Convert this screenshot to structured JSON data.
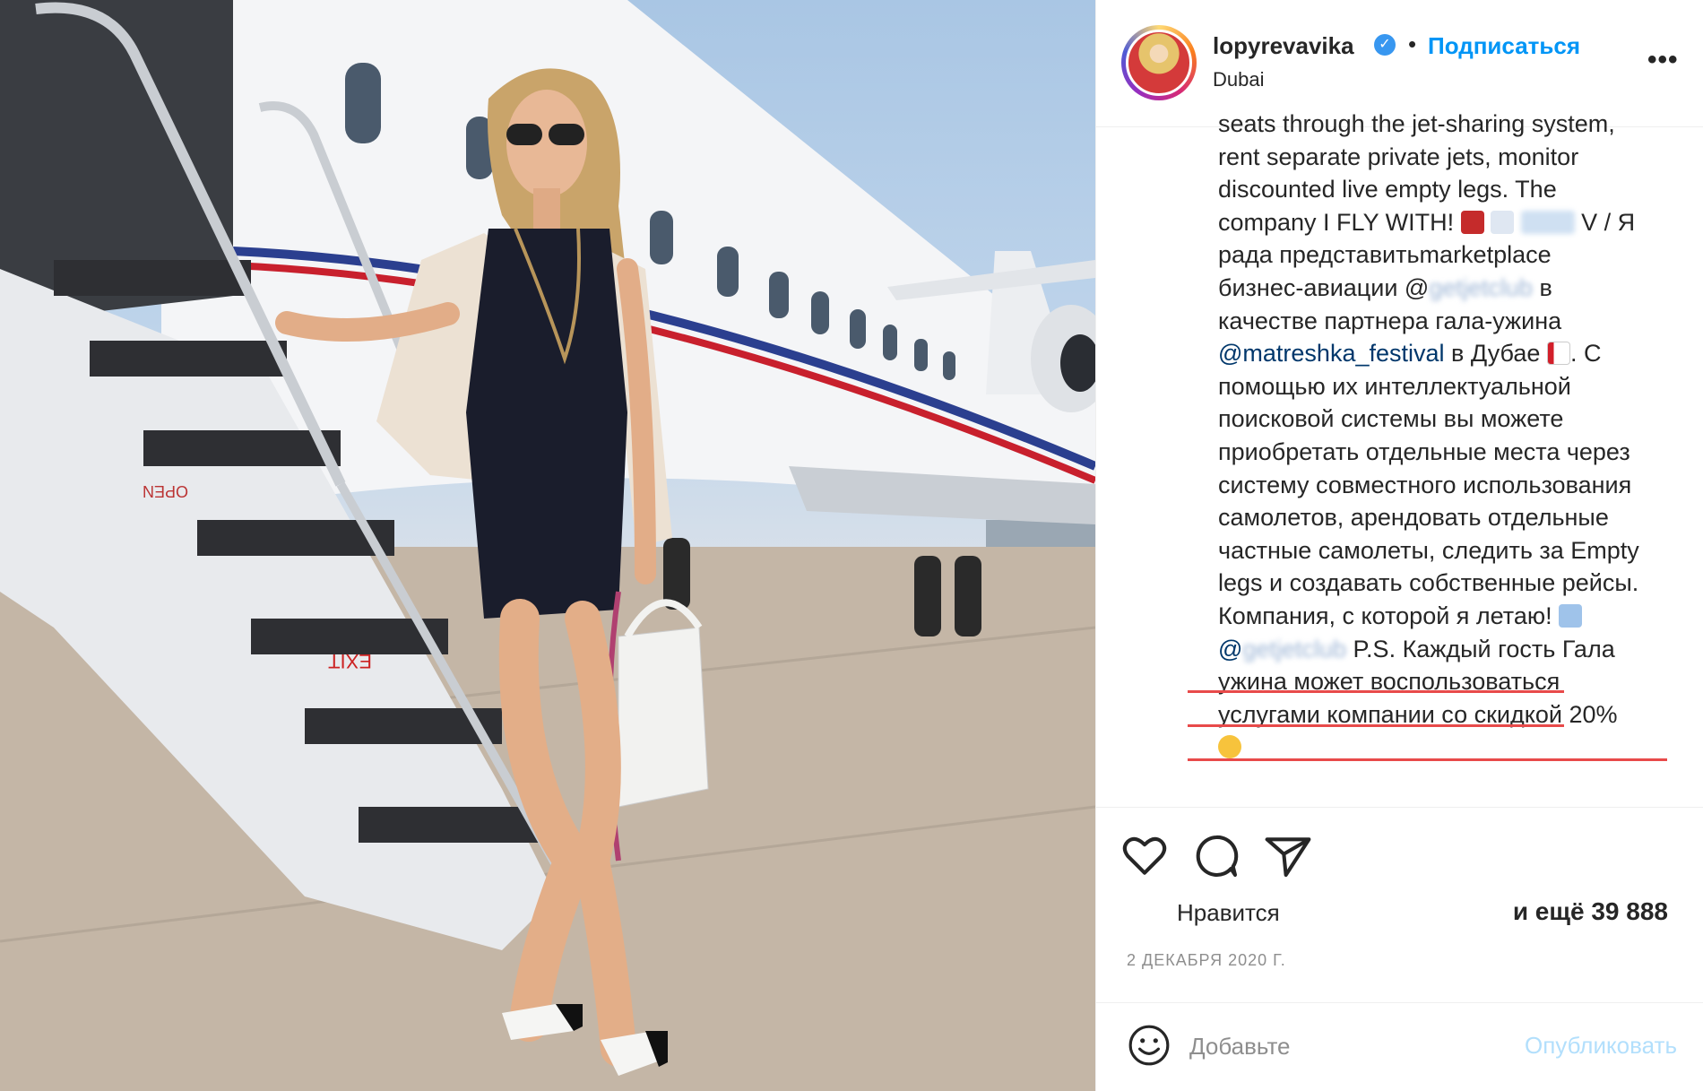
{
  "photo": {
    "icon": "post-photo",
    "alt": ""
  },
  "header": {
    "username": "lopyrevavika",
    "verified_icon": "verified-badge-icon",
    "separator": "•",
    "follow_label": "Подписаться",
    "location": "Dubai",
    "more_icon": "more-options-icon",
    "more_label": "•••"
  },
  "caption": {
    "lines": [
      "seats through the jet-sharing system,",
      "rent separate private jets, monitor",
      "discounted live empty legs. The",
      "company I FLY WITH!",
      "рада представитьmarketplace",
      "бизнес-авиации @",
      "качестве партнера гала-ужина",
      "@matreshka_festival",
      "помощью их интеллектуальной",
      "поисковой системы вы можете",
      "приобретать отдельные места через",
      "систему совместного использования",
      "самолетов, арендовать отдельные",
      "частные самолеты, следить за Empty",
      "legs и создавать собственные рейсы.",
      "Компания, с которой я летаю!",
      "@",
      "ужина может воспользоваться",
      "услугами компании со скидкой 20%"
    ],
    "line4_tail": "V / Я",
    "line6_tail": "в",
    "line8_tail": "в Дубае",
    "line8_tail2": ". С",
    "line17_tail": "P.S. Каждый гость Гала",
    "blurred_handle": "getjetclub",
    "accent": "#00376b",
    "underline_color": "#e84a4a"
  },
  "actions": {
    "like_icon": "heart-icon",
    "comment_icon": "comment-icon",
    "share_icon": "share-icon",
    "likes_label": "Нравится",
    "likes_count": "и ещё 39 888",
    "date": "2 ДЕКАБРЯ 2020 Г."
  },
  "comment_bar": {
    "emoji_icon": "smiley-icon",
    "placeholder": "Добавьте",
    "publish_label": "Опубликовать"
  },
  "colors": {
    "link_blue": "#0095f6",
    "publish_disabled": "#b2dffc",
    "muted": "#8e8e8e",
    "text": "#262626"
  }
}
